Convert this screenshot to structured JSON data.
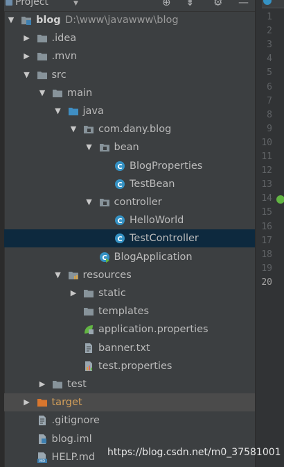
{
  "header": {
    "title": "Project"
  },
  "tree": [
    {
      "label": "blog",
      "path": "D:\\www\\javawww\\blog",
      "arrow": "down",
      "icon": "module-folder-icon",
      "depth": 0,
      "bold": true
    },
    {
      "label": ".idea",
      "arrow": "right",
      "icon": "folder-icon",
      "depth": 1
    },
    {
      "label": ".mvn",
      "arrow": "right",
      "icon": "folder-icon",
      "depth": 1
    },
    {
      "label": "src",
      "arrow": "down",
      "icon": "folder-icon",
      "depth": 1
    },
    {
      "label": "main",
      "arrow": "down",
      "icon": "folder-icon",
      "depth": 2
    },
    {
      "label": "java",
      "arrow": "down",
      "icon": "source-folder-icon",
      "depth": 3
    },
    {
      "label": "com.dany.blog",
      "arrow": "down",
      "icon": "package-icon",
      "depth": 4
    },
    {
      "label": "bean",
      "arrow": "down",
      "icon": "package-icon",
      "depth": 5
    },
    {
      "label": "BlogProperties",
      "arrow": "",
      "icon": "class-icon",
      "depth": 6
    },
    {
      "label": "TestBean",
      "arrow": "",
      "icon": "class-icon",
      "depth": 6
    },
    {
      "label": "controller",
      "arrow": "down",
      "icon": "package-icon",
      "depth": 5
    },
    {
      "label": "HelloWorld",
      "arrow": "",
      "icon": "class-icon",
      "depth": 6
    },
    {
      "label": "TestController",
      "arrow": "",
      "icon": "class-icon",
      "depth": 6,
      "selected": true
    },
    {
      "label": "BlogApplication",
      "arrow": "",
      "icon": "spring-boot-class-icon",
      "depth": 5
    },
    {
      "label": "resources",
      "arrow": "down",
      "icon": "resources-folder-icon",
      "depth": 3
    },
    {
      "label": "static",
      "arrow": "right",
      "icon": "folder-icon",
      "depth": 4
    },
    {
      "label": "templates",
      "arrow": "",
      "icon": "folder-icon",
      "depth": 4
    },
    {
      "label": "application.properties",
      "arrow": "",
      "icon": "spring-properties-icon",
      "depth": 4
    },
    {
      "label": "banner.txt",
      "arrow": "",
      "icon": "text-file-icon",
      "depth": 4
    },
    {
      "label": "test.properties",
      "arrow": "",
      "icon": "properties-file-icon",
      "depth": 4
    },
    {
      "label": "test",
      "arrow": "right",
      "icon": "folder-icon",
      "depth": 2
    },
    {
      "label": "target",
      "arrow": "right",
      "icon": "excluded-folder-icon",
      "depth": 1,
      "excluded": true,
      "orange": true
    },
    {
      "label": ".gitignore",
      "arrow": "",
      "icon": "text-file-icon",
      "depth": 1
    },
    {
      "label": "blog.iml",
      "arrow": "",
      "icon": "iml-file-icon",
      "depth": 1
    },
    {
      "label": "HELP.md",
      "arrow": "",
      "icon": "markdown-file-icon",
      "depth": 1
    }
  ],
  "gutter": {
    "line_numbers": [
      "1",
      "2",
      "3",
      "4",
      "5",
      "6",
      "7",
      "8",
      "9",
      "10",
      "11",
      "12",
      "13",
      "14",
      "15",
      "16",
      "17",
      "18",
      "19",
      "20"
    ],
    "current_line": "20"
  },
  "watermark": "https://blog.csdn.net/m0_37581001"
}
